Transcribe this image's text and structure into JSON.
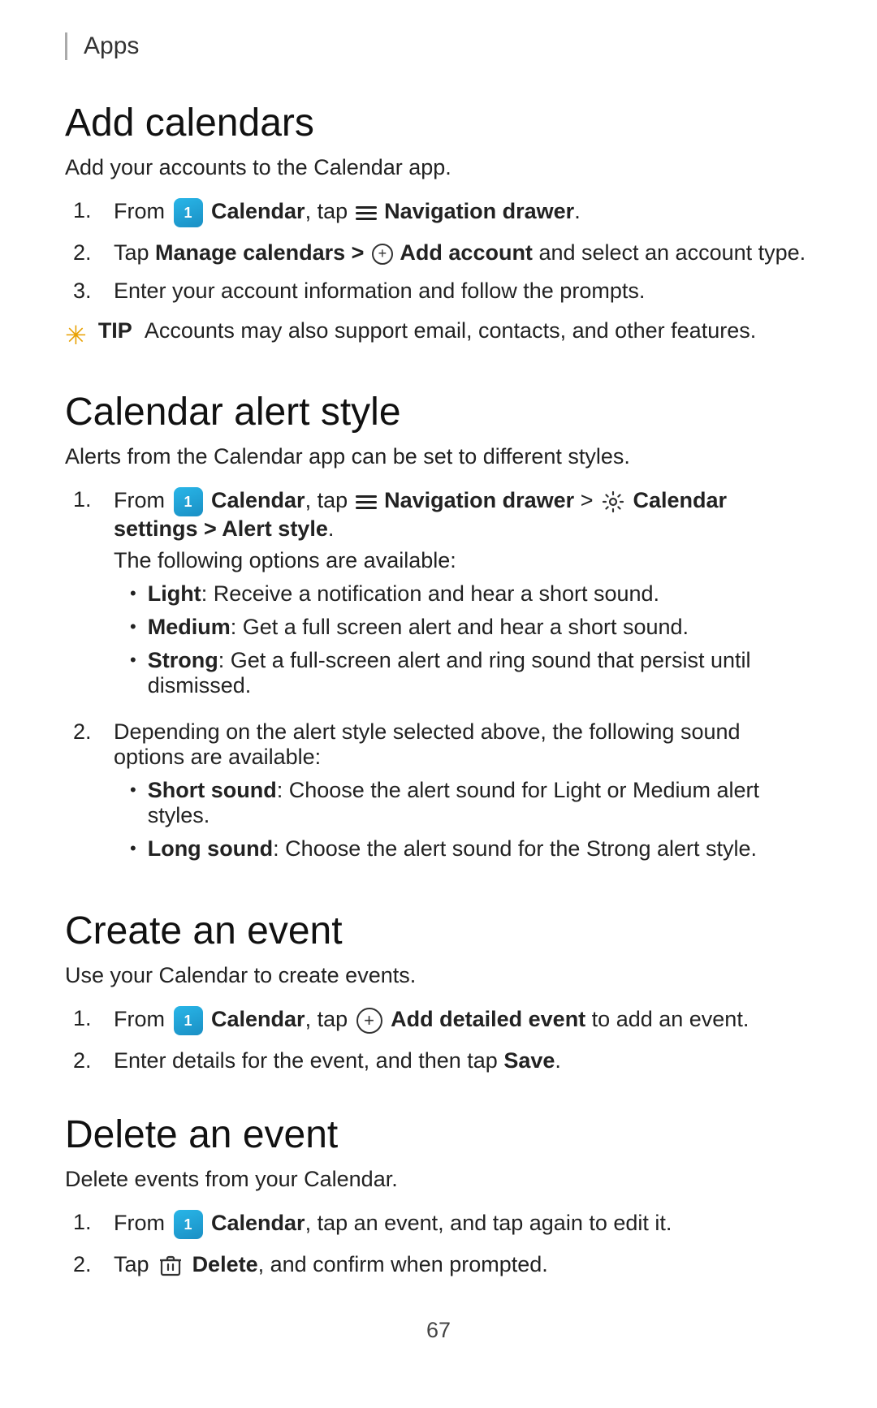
{
  "header": {
    "label": "Apps"
  },
  "sections": [
    {
      "id": "add-calendars",
      "title": "Add calendars",
      "subtitle": "Add your accounts to the Calendar app.",
      "steps": [
        {
          "id": "step-1",
          "html": "From <cal/> <b>Calendar</b>, tap <nav/> <b>Navigation drawer</b>."
        },
        {
          "id": "step-2",
          "html": "Tap <b>Manage calendars > <plus-inline/> Add account</b> and select an account type."
        },
        {
          "id": "step-3",
          "html": "Enter your account information and follow the prompts."
        }
      ],
      "tip": "Accounts may also support email, contacts, and other features."
    }
  ],
  "section_calendar_alert": {
    "title": "Calendar alert style",
    "subtitle": "Alerts from the Calendar app can be set to different styles.",
    "step1": "From <cal/> Calendar, tap <nav/> Navigation drawer > <gear/> Calendar settings > Alert style.",
    "step1_sub": "The following options are available:",
    "bullets1": [
      {
        "label": "Light",
        "text": "Receive a notification and hear a short sound."
      },
      {
        "label": "Medium",
        "text": "Get a full screen alert and hear a short sound."
      },
      {
        "label": "Strong",
        "text": "Get a full-screen alert and ring sound that persist until dismissed."
      }
    ],
    "step2": "Depending on the alert style selected above, the following sound options are available:",
    "bullets2": [
      {
        "label": "Short sound",
        "text": "Choose the alert sound for Light or Medium alert styles."
      },
      {
        "label": "Long sound",
        "text": "Choose the alert sound for the Strong alert style."
      }
    ]
  },
  "section_create": {
    "title": "Create an event",
    "subtitle": "Use your Calendar to create events.",
    "steps": [
      {
        "text": "From <cal/> Calendar, tap <plus/> Add detailed event to add an event."
      },
      {
        "text": "Enter details for the event, and then tap Save."
      }
    ]
  },
  "section_delete": {
    "title": "Delete an event",
    "subtitle": "Delete events from your Calendar.",
    "steps": [
      {
        "text": "From <cal/> Calendar, tap an event, and tap again to edit it."
      },
      {
        "text": "Tap <trash/> Delete, and confirm when prompted."
      }
    ]
  },
  "page_number": "67"
}
